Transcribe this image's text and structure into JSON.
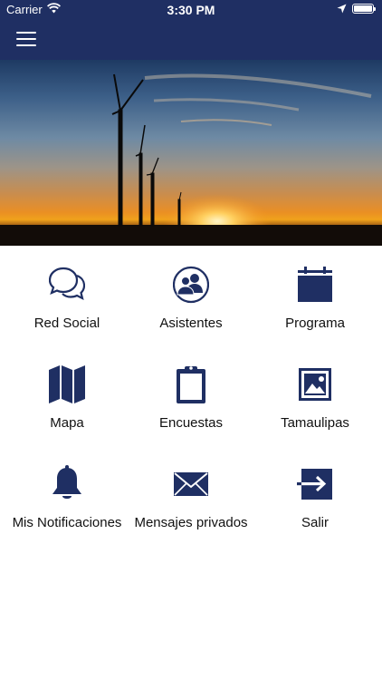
{
  "status": {
    "carrier": "Carrier",
    "time": "3:30 PM"
  },
  "header": {
    "menu_icon": "hamburger-menu-icon",
    "bar_color": "#1f2f63"
  },
  "carousel": {
    "total_slides": 5,
    "active_index": 0
  },
  "menu": [
    {
      "label": "Red Social",
      "icon": "chat-bubbles-icon"
    },
    {
      "label": "Asistentes",
      "icon": "people-icon"
    },
    {
      "label": "Programa",
      "icon": "calendar-icon"
    },
    {
      "label": "Mapa",
      "icon": "map-icon"
    },
    {
      "label": "Encuestas",
      "icon": "clipboard-icon"
    },
    {
      "label": "Tamaulipas",
      "icon": "image-icon"
    },
    {
      "label": "Mis Notificaciones",
      "icon": "bell-icon"
    },
    {
      "label": "Mensajes privados",
      "icon": "envelope-icon"
    },
    {
      "label": "Salir",
      "icon": "logout-icon"
    }
  ],
  "accent_color": "#1f2f63"
}
